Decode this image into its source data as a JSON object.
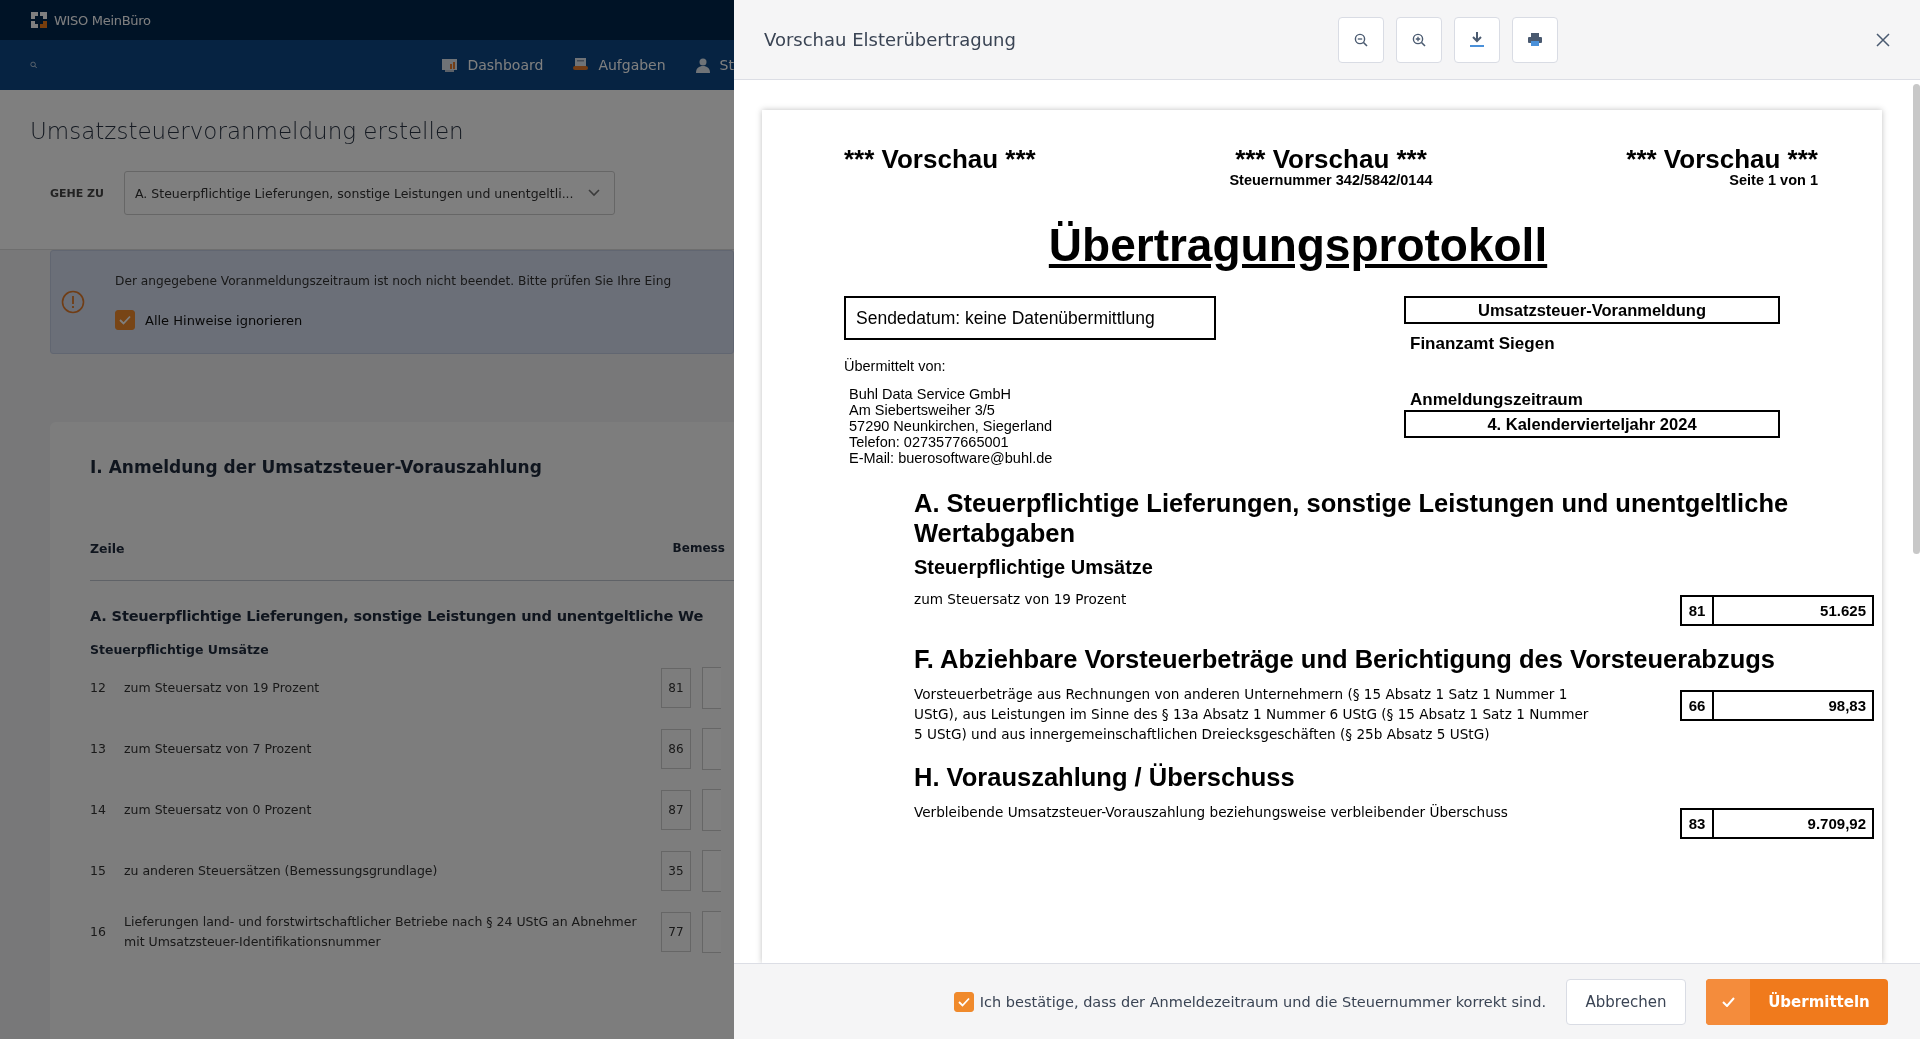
{
  "app": {
    "logo_text": "WISO MeinBüro",
    "nav": [
      "Dashboard",
      "Aufgaben",
      "St"
    ]
  },
  "page": {
    "title": "Umsatzsteuervoranmeldung erstellen",
    "goto_label": "GEHE ZU",
    "goto_value": "A. Steuerpflichtige Lieferungen, sonstige Leistungen und unentgeltli...",
    "notice": {
      "message": "Der angegebene Voranmeldungszeitraum ist noch nicht beendet. Bitte prüfen Sie Ihre Eing",
      "ignore_label": "Alle Hinweise ignorieren",
      "ignore_checked": true
    },
    "card": {
      "heading": "I. Anmeldung der Umsatzsteuer-Vorauszahlung",
      "columns": [
        "Zeile",
        "Bemess"
      ],
      "section_heading": "A. Steuerpflichtige Lieferungen, sonstige Leistungen und unentgeltliche We",
      "subsection": "Steuerpflichtige Umsätze",
      "rows": [
        {
          "line": "12",
          "label": "zum Steuersatz von 19 Prozent",
          "code": "81"
        },
        {
          "line": "13",
          "label": "zum Steuersatz von 7 Prozent",
          "code": "86"
        },
        {
          "line": "14",
          "label": "zum Steuersatz von 0 Prozent",
          "code": "87"
        },
        {
          "line": "15",
          "label": "zu anderen Steuersätzen (Bemessungsgrundlage)",
          "code": "35"
        },
        {
          "line": "16",
          "label": "Lieferungen land- und forstwirtschaftlicher Betriebe nach § 24 UStG an Abnehmer mit Umsatzsteuer-Identifikationsnummer",
          "code": "77"
        }
      ]
    }
  },
  "preview": {
    "title": "Vorschau Elsterübertragung",
    "document": {
      "header_left": "*** Vorschau ***",
      "header_center": "*** Vorschau ***",
      "tax_number": "Steuernummer 342/5842/0144",
      "header_right": "*** Vorschau ***",
      "page_info": "Seite 1 von 1",
      "title": "Übertragungsprotokoll",
      "send_date": "Sendedatum:  keine Datenübermittlung",
      "form_name": "Umsatzsteuer-Voranmeldung",
      "tax_office": "Finanzamt Siegen",
      "sender_label": "Übermittelt von:",
      "sender_lines": [
        "Buhl Data Service GmbH",
        "Am Siebertsweiher 3/5",
        "57290 Neunkirchen, Siegerland",
        "Telefon: 0273577665001",
        "E-Mail: buerosoftware@buhl.de"
      ],
      "period_label": "Anmeldungszeitraum",
      "period": "4. Kalendervierteljahr 2024",
      "sections": [
        {
          "heading": "A. Steuerpflichtige Lieferungen, sonstige Leistungen und unentgeltliche Wertabgaben",
          "subheading": "Steuerpflichtige Umsätze",
          "items": [
            {
              "text": "zum Steuersatz von 19 Prozent",
              "code": "81",
              "value": "51.625"
            }
          ]
        },
        {
          "heading": "F. Abziehbare Vorsteuerbeträge und Berichtigung des Vorsteuerabzugs",
          "items": [
            {
              "text": "Vorsteuerbeträge aus Rechnungen von anderen Unternehmern (§ 15 Absatz 1 Satz 1 Nummer 1 UStG), aus Leistungen im Sinne des § 13a Absatz 1 Nummer 6 UStG (§ 15 Absatz 1 Satz 1 Nummer 5 UStG) und aus innergemeinschaftlichen Dreiecksgeschäften (§ 25b Absatz 5 UStG)",
              "code": "66",
              "value": "98,83"
            }
          ]
        },
        {
          "heading": "H. Vorauszahlung / Überschuss",
          "items": [
            {
              "text": "Verbleibende Umsatzsteuer-Vorauszahlung beziehungsweise verbleibender Überschuss",
              "code": "83",
              "value": "9.709,92"
            }
          ]
        }
      ]
    },
    "confirm": {
      "label": "Ich bestätige, dass der Anmeldezeitraum und die Steuernummer korrekt sind.",
      "checked": true
    },
    "cancel": "Abbrechen",
    "submit": "Übermitteln"
  }
}
